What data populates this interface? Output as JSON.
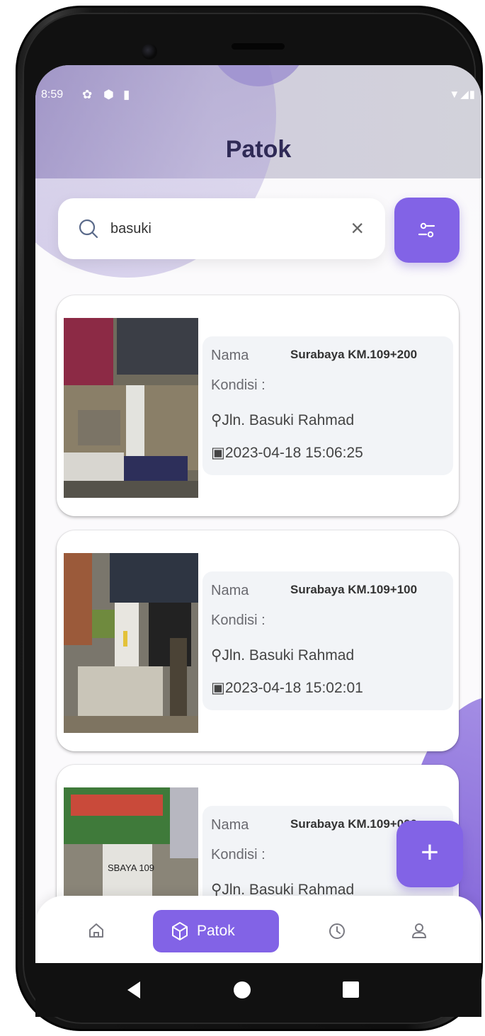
{
  "status_bar": {
    "time": "8:59"
  },
  "header": {
    "title": "Patok"
  },
  "search": {
    "value": "basuki",
    "clear_label": "×"
  },
  "cards": [
    {
      "nama_label": "Nama",
      "nama": "Surabaya KM.109+200",
      "kondisi_label": "Kondisi :",
      "location": "Jln. Basuki Rahmad",
      "date": "2023-04-18 15:06:25"
    },
    {
      "nama_label": "Nama",
      "nama": "Surabaya KM.109+100",
      "kondisi_label": "Kondisi :",
      "location": "Jln. Basuki Rahmad",
      "date": "2023-04-18 15:02:01"
    },
    {
      "nama_label": "Nama",
      "nama": "Surabaya KM.109+000",
      "kondisi_label": "Kondisi :",
      "location": "Jln. Basuki Rahmad",
      "date": ""
    }
  ],
  "photo_marker_text": "SBAYA 109",
  "fab": {
    "label": "+"
  },
  "bottom_nav": {
    "items": [
      {
        "icon": "home-icon"
      },
      {
        "label": "Patok",
        "icon": "cube-icon"
      },
      {
        "icon": "clock-icon"
      },
      {
        "icon": "user-icon"
      }
    ]
  },
  "colors": {
    "accent": "#8263e6",
    "title": "#2f2a56"
  }
}
